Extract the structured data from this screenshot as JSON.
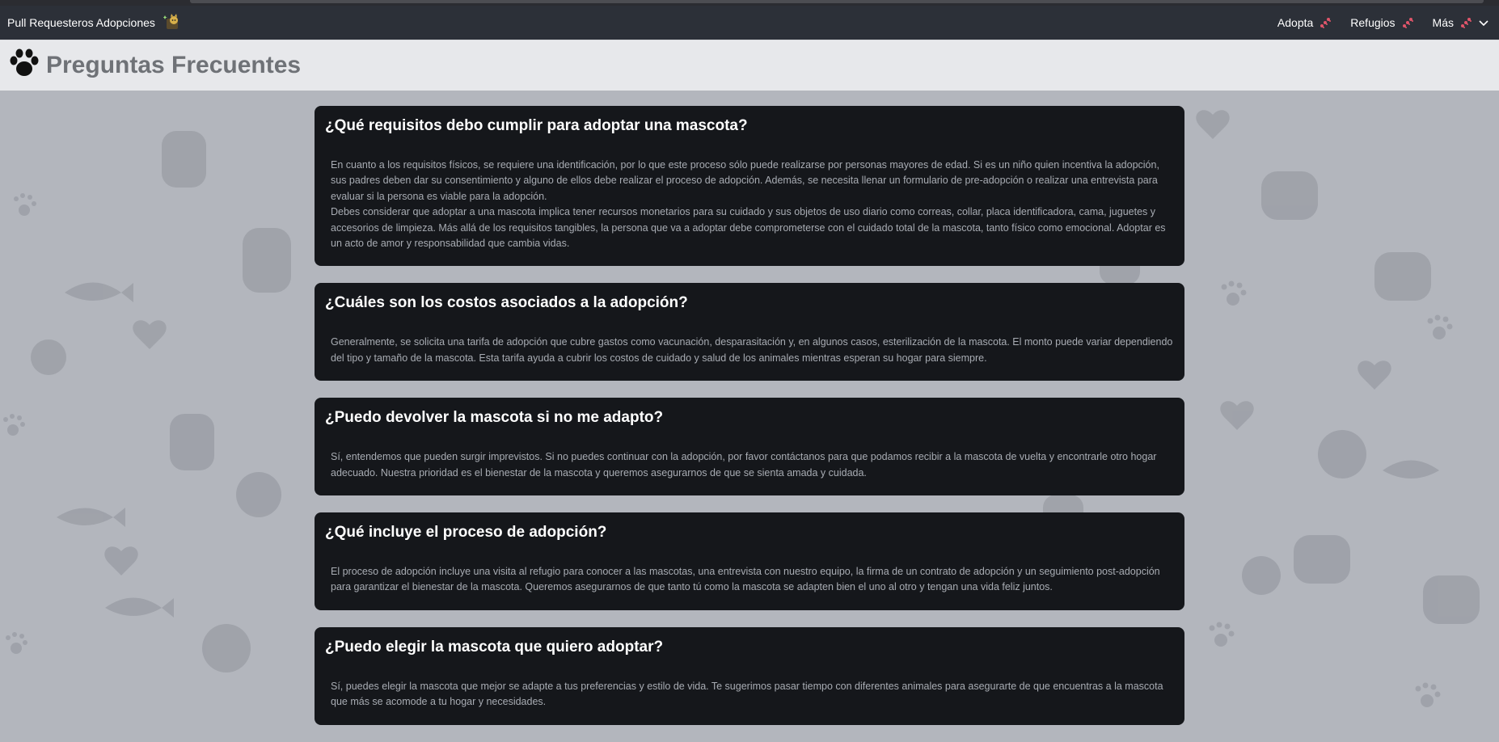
{
  "navbar": {
    "brand": "Pull Requesteros Adopciones",
    "items": [
      {
        "label": "Adopta"
      },
      {
        "label": "Refugios"
      },
      {
        "label": "Más"
      }
    ]
  },
  "header": {
    "title": "Preguntas Frecuentes"
  },
  "faqs": [
    {
      "question": "¿Qué requisitos debo cumplir para adoptar una mascota?",
      "answer": "En cuanto a los requisitos físicos, se requiere una identificación, por lo que este proceso sólo puede realizarse por personas mayores de edad. Si es un niño quien incentiva la adopción, sus padres deben dar su consentimiento y alguno de ellos debe realizar el proceso de adopción. Además, se necesita llenar un formulario de pre-adopción o realizar una entrevista para evaluar si la persona es viable para la adopción.\nDebes considerar que adoptar a una mascota implica tener recursos monetarios para su cuidado y sus objetos de uso diario como correas, collar, placa identificadora, cama, juguetes y accesorios de limpieza. Más allá de los requisitos tangibles, la persona que va a adoptar debe comprometerse con el cuidado total de la mascota, tanto físico como emocional. Adoptar es un acto de amor y responsabilidad que cambia vidas."
    },
    {
      "question": "¿Cuáles son los costos asociados a la adopción?",
      "answer": "Generalmente, se solicita una tarifa de adopción que cubre gastos como vacunación, desparasitación y, en algunos casos, esterilización de la mascota. El monto puede variar dependiendo del tipo y tamaño de la mascota. Esta tarifa ayuda a cubrir los costos de cuidado y salud de los animales mientras esperan su hogar para siempre."
    },
    {
      "question": "¿Puedo devolver la mascota si no me adapto?",
      "answer": "Sí, entendemos que pueden surgir imprevistos. Si no puedes continuar con la adopción, por favor contáctanos para que podamos recibir a la mascota de vuelta y encontrarle otro hogar adecuado. Nuestra prioridad es el bienestar de la mascota y queremos asegurarnos de que se sienta amada y cuidada."
    },
    {
      "question": "¿Qué incluye el proceso de adopción?",
      "answer": "El proceso de adopción incluye una visita al refugio para conocer a las mascotas, una entrevista con nuestro equipo, la firma de un contrato de adopción y un seguimiento post-adopción para garantizar el bienestar de la mascota. Queremos asegurarnos de que tanto tú como la mascota se adapten bien el uno al otro y tengan una vida feliz juntos."
    },
    {
      "question": "¿Puedo elegir la mascota que quiero adoptar?",
      "answer": "Sí, puedes elegir la mascota que mejor se adapte a tus preferencias y estilo de vida. Te sugerimos pasar tiempo con diferentes animales para asegurarte de que encuentras a la mascota que más se acomode a tu hogar y necesidades."
    }
  ]
}
